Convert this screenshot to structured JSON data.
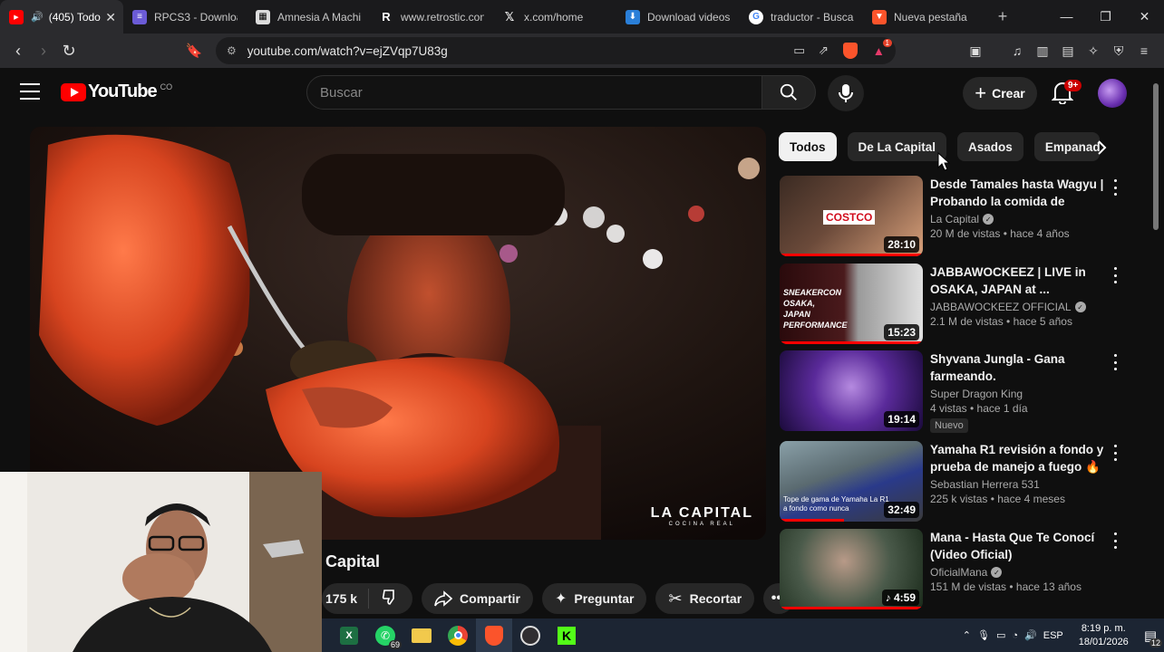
{
  "browser": {
    "tabs": [
      {
        "title": "(405) Todo",
        "favicon": "youtube-icon",
        "active": true
      },
      {
        "title": "RPCS3 - Downloa",
        "favicon": "rpcs3-icon"
      },
      {
        "title": "Amnesia A Machi",
        "favicon": "amnesia-icon"
      },
      {
        "title": "www.retrostic.con",
        "favicon": "retrostic-icon"
      },
      {
        "title": "x.com/home",
        "favicon": "x-icon"
      },
      {
        "title": "Download videos",
        "favicon": "download-icon"
      },
      {
        "title": "traductor - Buscar",
        "favicon": "google-icon"
      },
      {
        "title": "Nueva pestaña",
        "favicon": "brave-icon"
      }
    ],
    "url": "youtube.com/watch?v=ejZVqp7U83g",
    "brave_shield_count": "1"
  },
  "youtube": {
    "logo_text": "YouTube",
    "country_code": "CO",
    "search_placeholder": "Buscar",
    "create_label": "Crear",
    "notification_count": "9+"
  },
  "video": {
    "title": "Capital",
    "like_count": "175 k",
    "brand_line1": "LA CAPITAL",
    "brand_line2": "COCINA REAL",
    "actions": {
      "share": "Compartir",
      "ask": "Preguntar",
      "clip": "Recortar"
    }
  },
  "chips": [
    "Todos",
    "De La Capital",
    "Asados",
    "Empanadas"
  ],
  "recommendations": [
    {
      "title": "Desde Tamales hasta Wagyu | Probando la comida de Costco...",
      "channel": "La Capital",
      "verified": true,
      "meta": "20 M de vistas • hace 4 años",
      "duration": "28:10",
      "thumb_text": "COSTCO",
      "badge": "",
      "progress": 1.0
    },
    {
      "title": "JABBAWOCKEEZ | LIVE in OSAKA, JAPAN at ...",
      "channel": "JABBAWOCKEEZ OFFICIAL",
      "verified": true,
      "meta": "2.1 M de vistas • hace 5 años",
      "duration": "15:23",
      "thumb_text": "SNEAKERCON OSAKA, JAPAN PERFORMANCE",
      "badge": "",
      "progress": 1.0
    },
    {
      "title": "Shyvana Jungla - Gana farmeando.",
      "channel": "Super Dragon King",
      "verified": false,
      "meta": "4 vistas • hace 1 día",
      "duration": "19:14",
      "thumb_text": "",
      "badge": "Nuevo",
      "progress": 0
    },
    {
      "title": "Yamaha R1 revisión a fondo y prueba de manejo a fuego 🔥",
      "channel": "Sebastian Herrera 531",
      "verified": false,
      "meta": "225 k vistas • hace 4 meses",
      "duration": "32:49",
      "thumb_text": "Tope de gama de Yamaha La R1 a fondo como nunca",
      "badge": "",
      "progress": 0.45
    },
    {
      "title": "Mana - Hasta Que Te Conocí (Video Oficial)",
      "channel": "OficialMana",
      "verified": true,
      "meta": "151 M de vistas • hace 13 años",
      "duration": "4:59",
      "thumb_text": "",
      "badge": "",
      "progress": 1.0
    }
  ],
  "taskbar": {
    "whatsapp_count": "69",
    "language": "ESP",
    "time": "8:19 p. m.",
    "date": "18/01/2026",
    "notifications": "12"
  }
}
